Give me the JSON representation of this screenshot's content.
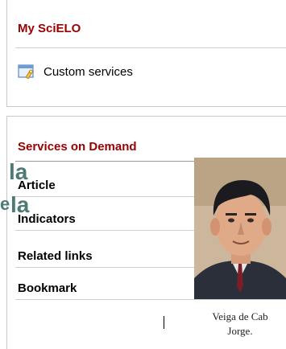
{
  "my_scielo": {
    "title": "My SciELO",
    "items": [
      {
        "label": "Custom services",
        "icon": "custom-services-icon"
      }
    ]
  },
  "services": {
    "title": "Services on Demand",
    "items": [
      {
        "label": "Article"
      },
      {
        "label": "Indicators"
      },
      {
        "label": "Related links"
      },
      {
        "label": "Bookmark"
      }
    ]
  },
  "overlay_text": {
    "first": "la",
    "second": "la",
    "edge_char": "e"
  },
  "photo": {
    "caption_line1": "Veiga de Cab",
    "caption_line2": "Jorge."
  },
  "colors": {
    "section_title": "#990000",
    "overlay_text": "#4e7a76",
    "border": "#c8c8c8"
  }
}
